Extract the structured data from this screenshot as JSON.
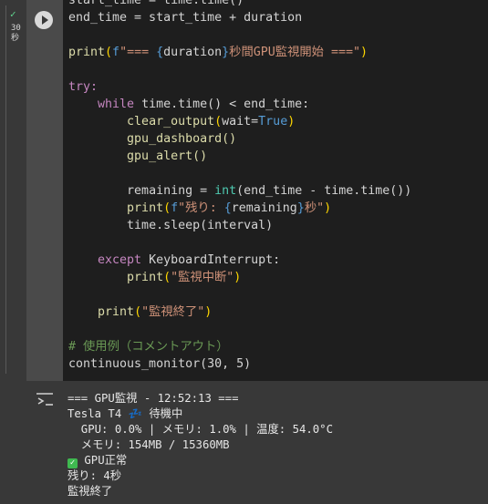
{
  "gutter": {
    "check_glyph": "✓",
    "exec_time_line1": "30",
    "exec_time_line2": "秒"
  },
  "code": {
    "l0": "start_time = time.time()",
    "l1": "end_time = start_time + duration",
    "l2_pre": "print(",
    "l2_f": "f",
    "l2_s1": "\"===",
    "l2_var": "duration",
    "l2_s2": "秒間GPU監視開始 ===\"",
    "l2_post": ")",
    "l3": "try:",
    "l4_kw": "while",
    "l4_rest": " time.time() < end_time:",
    "l5_fn": "clear_output",
    "l5_arg": "wait=",
    "l5_bool": "True",
    "l6": "gpu_dashboard()",
    "l7": "gpu_alert()",
    "l8_pre": "remaining = ",
    "l8_int": "int",
    "l8_rest": "(end_time - time.time())",
    "l9_s1": "\"残り: ",
    "l9_var": "remaining",
    "l9_s2": "秒\"",
    "l10": "time.sleep(interval)",
    "l11_kw": "except",
    "l11_rest": " KeyboardInterrupt:",
    "l12_str": "\"監視中断\"",
    "l13_str": "\"監視終了\"",
    "comment": "# 使用例（コメントアウト）",
    "call": "continuous_monitor(30, 5)"
  },
  "output": {
    "line1": "=== GPU監視 - 12:52:13 ===",
    "line2_pre": "Tesla T4 ",
    "line2_icon": "💤",
    "line2_post": " 待機中",
    "line3": "  GPU: 0.0% | メモリ: 1.0% | 温度: 54.0°C",
    "line4": "  メモリ: 154MB / 15360MB",
    "line5_icon": "✓",
    "line5_text": " GPU正常",
    "line6": "残り: 4秒",
    "line7": "監視終了"
  }
}
